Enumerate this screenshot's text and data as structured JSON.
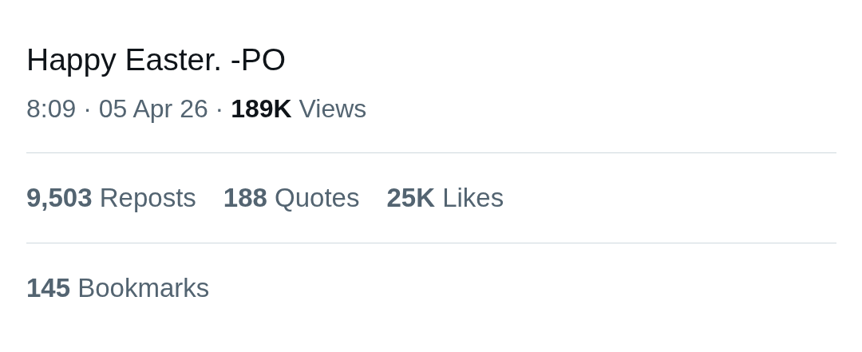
{
  "post": {
    "text": "Happy Easter. -PO",
    "meta": "8:09 · 05 Apr 26 · **189K** Views"
  },
  "stats_rows": [
    {
      "stats": [
        "**9,503** Reposts",
        "**188** Quotes",
        "**25K** Likes"
      ]
    },
    {
      "stats": [
        "**145** Bookmarks"
      ]
    }
  ]
}
